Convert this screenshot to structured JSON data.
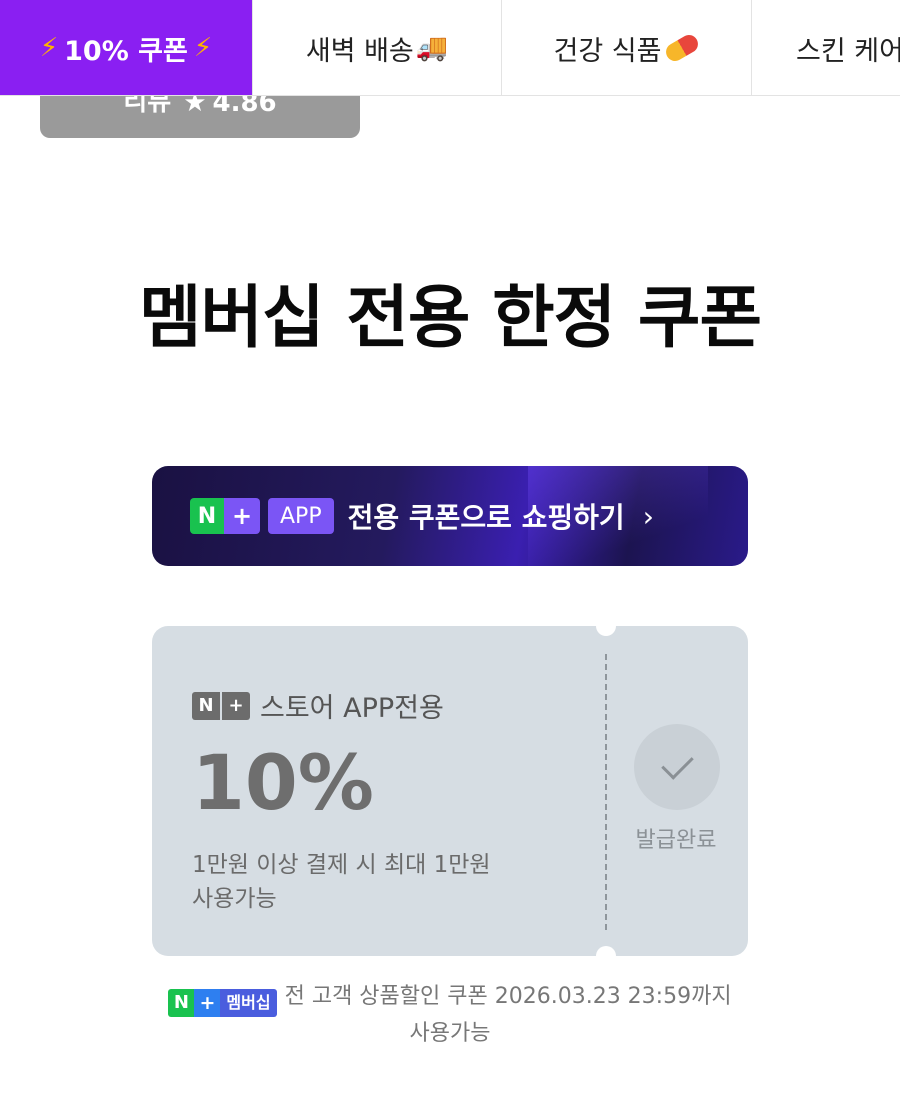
{
  "tabs": [
    {
      "label": "10% 쿠폰",
      "active": true
    },
    {
      "label": "새벽 배송"
    },
    {
      "label": "건강 식품"
    },
    {
      "label": "스킨 케어"
    }
  ],
  "review_badge": {
    "prefix": "리뷰",
    "rating": "4.86"
  },
  "headline": "멤버십 전용 한정 쿠폰",
  "app_banner": {
    "n_mark": "N",
    "plus_mark": "+",
    "app_label": "APP",
    "text": "전용 쿠폰으로 쇼핑하기",
    "chevron": "›"
  },
  "coupon": {
    "tag_n": "N",
    "tag_plus": "+",
    "tag_label": "스토어 APP전용",
    "discount": "10%",
    "condition_line1": "1만원 이상 결제 시 최대 1만원",
    "condition_line2": "사용가능",
    "status": "발급완료"
  },
  "footnote": {
    "badge_n": "N",
    "badge_plus": "+",
    "badge_label": "멤버십",
    "line1": "전 고객 상품할인 쿠폰 2026.03.23 23:59까지",
    "line2": "사용가능"
  }
}
